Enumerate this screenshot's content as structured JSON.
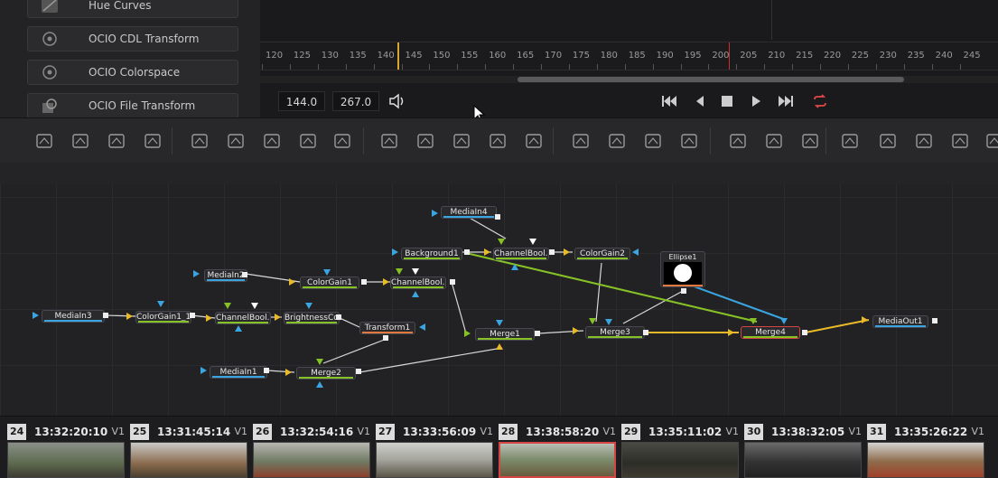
{
  "effects": {
    "items": [
      {
        "label": "Hue Curves",
        "icon": "curves-icon"
      },
      {
        "label": "OCIO CDL Transform",
        "icon": "ocio-icon"
      },
      {
        "label": "OCIO Colorspace",
        "icon": "ocio-icon"
      },
      {
        "label": "OCIO File Transform",
        "icon": "ocio-file-icon"
      }
    ]
  },
  "ruler": {
    "ticks": [
      "120",
      "125",
      "130",
      "135",
      "140",
      "145",
      "150",
      "155",
      "160",
      "165",
      "170",
      "175",
      "180",
      "185",
      "190",
      "195",
      "200",
      "205",
      "210",
      "215",
      "220",
      "225",
      "230",
      "235",
      "240",
      "245"
    ]
  },
  "transport": {
    "current_time": "144.0",
    "end_time": "267.0"
  },
  "toolbar": {
    "tools": [
      "background-icon",
      "fast-noise-icon",
      "text-icon",
      "paint-icon",
      "particles-icon",
      "color-corrector-icon",
      "curves-icon",
      "brightness-contrast-icon",
      "blur-icon",
      "loader-icon",
      "merge-icon",
      "channel-booleans-icon",
      "resize-icon",
      "transform-icon",
      "rectangle-icon",
      "ellipse-icon",
      "polygon-icon",
      "bspline-icon",
      "particle-emitter-icon",
      "particle-render-icon",
      "pattern-icon",
      "shape3d-icon",
      "merge3d-icon",
      "text3d-icon",
      "renderer3d-icon",
      "camera3d-icon"
    ]
  },
  "nodes": {
    "mediain4": "MediaIn4",
    "background1": "Background1",
    "channelbool_a": "ChannelBool...",
    "colorgain2": "ColorGain2",
    "ellipse1": "Ellipse1",
    "mediain2": "MediaIn2",
    "colorgain1": "ColorGain1",
    "channelbool_b": "ChannelBool...",
    "mediain3": "MediaIn3",
    "colorgain1_1": "ColorGain1_1",
    "channelbool_c": "ChannelBool...",
    "brightness": "BrightnessCo...",
    "transform1": "Transform1",
    "merge1": "Merge1",
    "merge3": "Merge3",
    "merge4": "Merge4",
    "mediaout1": "MediaOut1",
    "mediain1": "MediaIn1",
    "merge2": "Merge2"
  },
  "colors": {
    "playhead": "#d8a432",
    "selection": "#d64545",
    "link_yellow": "#e8b928",
    "link_green": "#86c226",
    "link_blue": "#3aa5e0"
  },
  "clips": [
    {
      "num": "24",
      "timecode": "13:32:20:10",
      "track": "V1"
    },
    {
      "num": "25",
      "timecode": "13:31:45:14",
      "track": "V1"
    },
    {
      "num": "26",
      "timecode": "13:32:54:16",
      "track": "V1"
    },
    {
      "num": "27",
      "timecode": "13:33:56:09",
      "track": "V1"
    },
    {
      "num": "28",
      "timecode": "13:38:58:20",
      "track": "V1"
    },
    {
      "num": "29",
      "timecode": "13:35:11:02",
      "track": "V1"
    },
    {
      "num": "30",
      "timecode": "13:38:32:05",
      "track": "V1"
    },
    {
      "num": "31",
      "timecode": "13:35:26:22",
      "track": "V1"
    }
  ]
}
